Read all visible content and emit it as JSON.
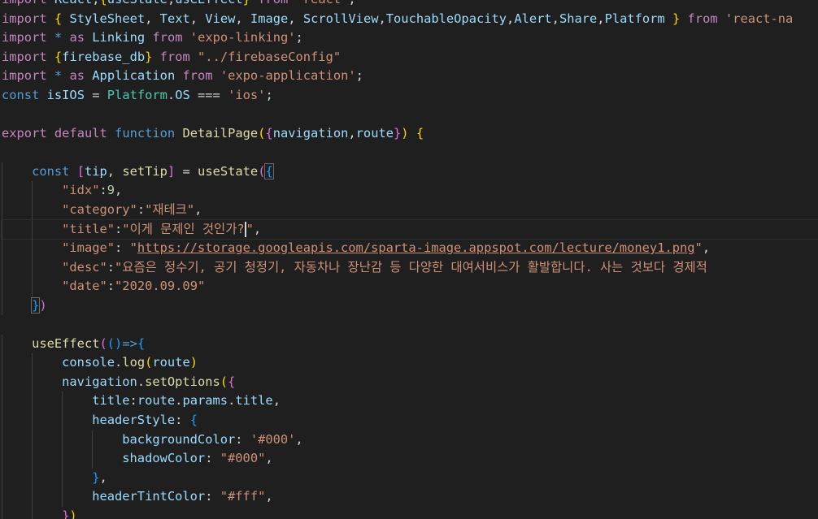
{
  "editor": {
    "language": "javascript",
    "lines": [
      [
        [
          "kw-ctrl",
          "import"
        ],
        [
          "pun",
          " "
        ],
        [
          "var",
          "React"
        ],
        [
          "pun",
          ","
        ],
        [
          "b1",
          "{"
        ],
        [
          "var",
          "useState"
        ],
        [
          "pun",
          ","
        ],
        [
          "var",
          "useEffect"
        ],
        [
          "b1",
          "}"
        ],
        [
          "pun",
          " "
        ],
        [
          "kw-ctrl",
          "from"
        ],
        [
          "pun",
          " "
        ],
        [
          "str",
          "'react'"
        ],
        [
          "pun",
          ";"
        ]
      ],
      [
        [
          "kw-ctrl",
          "import"
        ],
        [
          "pun",
          " "
        ],
        [
          "b1",
          "{"
        ],
        [
          "pun",
          " "
        ],
        [
          "var",
          "StyleSheet"
        ],
        [
          "pun",
          ", "
        ],
        [
          "var",
          "Text"
        ],
        [
          "pun",
          ", "
        ],
        [
          "var",
          "View"
        ],
        [
          "pun",
          ", "
        ],
        [
          "var",
          "Image"
        ],
        [
          "pun",
          ", "
        ],
        [
          "var",
          "ScrollView"
        ],
        [
          "pun",
          ","
        ],
        [
          "var",
          "TouchableOpacity"
        ],
        [
          "pun",
          ","
        ],
        [
          "var",
          "Alert"
        ],
        [
          "pun",
          ","
        ],
        [
          "var",
          "Share"
        ],
        [
          "pun",
          ","
        ],
        [
          "var",
          "Platform"
        ],
        [
          "pun",
          " "
        ],
        [
          "b1",
          "}"
        ],
        [
          "pun",
          " "
        ],
        [
          "kw-ctrl",
          "from"
        ],
        [
          "pun",
          " "
        ],
        [
          "str",
          "'react-na"
        ]
      ],
      [
        [
          "kw-ctrl",
          "import"
        ],
        [
          "pun",
          " "
        ],
        [
          "kw",
          "*"
        ],
        [
          "pun",
          " "
        ],
        [
          "kw-ctrl",
          "as"
        ],
        [
          "pun",
          " "
        ],
        [
          "var",
          "Linking"
        ],
        [
          "pun",
          " "
        ],
        [
          "kw-ctrl",
          "from"
        ],
        [
          "pun",
          " "
        ],
        [
          "str",
          "'expo-linking'"
        ],
        [
          "pun",
          ";"
        ]
      ],
      [
        [
          "kw-ctrl",
          "import"
        ],
        [
          "pun",
          " "
        ],
        [
          "b1",
          "{"
        ],
        [
          "var",
          "firebase_db"
        ],
        [
          "b1",
          "}"
        ],
        [
          "pun",
          " "
        ],
        [
          "kw-ctrl",
          "from"
        ],
        [
          "pun",
          " "
        ],
        [
          "str",
          "\"../firebaseConfig\""
        ]
      ],
      [
        [
          "kw-ctrl",
          "import"
        ],
        [
          "pun",
          " "
        ],
        [
          "kw",
          "*"
        ],
        [
          "pun",
          " "
        ],
        [
          "kw-ctrl",
          "as"
        ],
        [
          "pun",
          " "
        ],
        [
          "var",
          "Application"
        ],
        [
          "pun",
          " "
        ],
        [
          "kw-ctrl",
          "from"
        ],
        [
          "pun",
          " "
        ],
        [
          "str",
          "'expo-application'"
        ],
        [
          "pun",
          ";"
        ]
      ],
      [
        [
          "kw",
          "const"
        ],
        [
          "pun",
          " "
        ],
        [
          "var",
          "isIOS"
        ],
        [
          "pun",
          " = "
        ],
        [
          "cls",
          "Platform"
        ],
        [
          "pun",
          "."
        ],
        [
          "var",
          "OS"
        ],
        [
          "pun",
          " === "
        ],
        [
          "str",
          "'ios'"
        ],
        [
          "pun",
          ";"
        ]
      ],
      [],
      [
        [
          "kw-ctrl",
          "export"
        ],
        [
          "pun",
          " "
        ],
        [
          "kw-ctrl",
          "default"
        ],
        [
          "pun",
          " "
        ],
        [
          "kw",
          "function"
        ],
        [
          "pun",
          " "
        ],
        [
          "fn",
          "DetailPage"
        ],
        [
          "b1",
          "("
        ],
        [
          "b2",
          "{"
        ],
        [
          "var",
          "navigation"
        ],
        [
          "pun",
          ","
        ],
        [
          "var",
          "route"
        ],
        [
          "b2",
          "}"
        ],
        [
          "b1",
          ")"
        ],
        [
          "pun",
          " "
        ],
        [
          "b1",
          "{"
        ]
      ],
      [],
      [
        [
          "pun",
          "    "
        ],
        [
          "kw",
          "const"
        ],
        [
          "pun",
          " "
        ],
        [
          "b2",
          "["
        ],
        [
          "var",
          "tip"
        ],
        [
          "pun",
          ", "
        ],
        [
          "fn",
          "setTip"
        ],
        [
          "b2",
          "]"
        ],
        [
          "pun",
          " = "
        ],
        [
          "fn",
          "useState"
        ],
        [
          "b2",
          "("
        ],
        [
          "b3bhl",
          "{"
        ]
      ],
      [
        [
          "pun",
          "        "
        ],
        [
          "str",
          "\"idx\""
        ],
        [
          "pun",
          ":"
        ],
        [
          "num",
          "9"
        ],
        [
          "pun",
          ","
        ]
      ],
      [
        [
          "pun",
          "        "
        ],
        [
          "str",
          "\"category\""
        ],
        [
          "pun",
          ":"
        ],
        [
          "str",
          "\"재테크\""
        ],
        [
          "pun",
          ","
        ]
      ],
      [
        [
          "pun",
          "        "
        ],
        [
          "str",
          "\"title\""
        ],
        [
          "pun",
          ":"
        ],
        [
          "str",
          "\"이게 문제인 것인가?"
        ],
        [
          "caret",
          ""
        ],
        [
          "str",
          "\""
        ],
        [
          "pun",
          ","
        ]
      ],
      [
        [
          "pun",
          "        "
        ],
        [
          "str",
          "\"image\""
        ],
        [
          "pun",
          ": "
        ],
        [
          "str",
          "\""
        ],
        [
          "url",
          "https://storage.googleapis.com/sparta-image.appspot.com/lecture/money1.png"
        ],
        [
          "str",
          "\""
        ],
        [
          "pun",
          ","
        ]
      ],
      [
        [
          "pun",
          "        "
        ],
        [
          "str",
          "\"desc\""
        ],
        [
          "pun",
          ":"
        ],
        [
          "str",
          "\"요즘은 정수기, 공기 청정기, 자동차나 장난감 등 다양한 대여서비스가 활발합니다. 사는 것보다 경제적"
        ]
      ],
      [
        [
          "pun",
          "        "
        ],
        [
          "str",
          "\"date\""
        ],
        [
          "pun",
          ":"
        ],
        [
          "str",
          "\"2020.09.09\""
        ]
      ],
      [
        [
          "pun",
          "    "
        ],
        [
          "b3bhl",
          "}"
        ],
        [
          "b2",
          ")"
        ]
      ],
      [],
      [
        [
          "pun",
          "    "
        ],
        [
          "fn",
          "useEffect"
        ],
        [
          "b2",
          "("
        ],
        [
          "b3",
          "()"
        ],
        [
          "kw",
          "=>"
        ],
        [
          "b3",
          "{"
        ]
      ],
      [
        [
          "pun",
          "        "
        ],
        [
          "var",
          "console"
        ],
        [
          "pun",
          "."
        ],
        [
          "fn",
          "log"
        ],
        [
          "b1",
          "("
        ],
        [
          "var",
          "route"
        ],
        [
          "b1",
          ")"
        ]
      ],
      [
        [
          "pun",
          "        "
        ],
        [
          "var",
          "navigation"
        ],
        [
          "pun",
          "."
        ],
        [
          "fn",
          "setOptions"
        ],
        [
          "b1",
          "("
        ],
        [
          "b2",
          "{"
        ]
      ],
      [
        [
          "pun",
          "            "
        ],
        [
          "var",
          "title"
        ],
        [
          "pun",
          ":"
        ],
        [
          "var",
          "route"
        ],
        [
          "pun",
          "."
        ],
        [
          "var",
          "params"
        ],
        [
          "pun",
          "."
        ],
        [
          "var",
          "title"
        ],
        [
          "pun",
          ","
        ]
      ],
      [
        [
          "pun",
          "            "
        ],
        [
          "var",
          "headerStyle"
        ],
        [
          "pun",
          ": "
        ],
        [
          "b3",
          "{"
        ]
      ],
      [
        [
          "pun",
          "                "
        ],
        [
          "var",
          "backgroundColor"
        ],
        [
          "pun",
          ": "
        ],
        [
          "str",
          "'#000'"
        ],
        [
          "pun",
          ","
        ]
      ],
      [
        [
          "pun",
          "                "
        ],
        [
          "var",
          "shadowColor"
        ],
        [
          "pun",
          ": "
        ],
        [
          "str",
          "\"#000\""
        ],
        [
          "pun",
          ","
        ]
      ],
      [
        [
          "pun",
          "            "
        ],
        [
          "b3",
          "}"
        ],
        [
          "pun",
          ","
        ]
      ],
      [
        [
          "pun",
          "            "
        ],
        [
          "var",
          "headerTintColor"
        ],
        [
          "pun",
          ": "
        ],
        [
          "str",
          "\"#fff\""
        ],
        [
          "pun",
          ","
        ]
      ],
      [
        [
          "pun",
          "        "
        ],
        [
          "b2",
          "}"
        ],
        [
          "b1",
          ")"
        ]
      ]
    ],
    "current_line": 12,
    "colors": {
      "background": "#1f1f1f",
      "keyword_control": "#c586c0",
      "keyword": "#569cd6",
      "function": "#dcdcaa",
      "variable": "#9cdcfe",
      "class": "#4ec9b0",
      "string": "#ce9178",
      "number": "#b5cea8",
      "bracket_1": "#ffd700",
      "bracket_2": "#da70d6",
      "bracket_3": "#179fff"
    }
  }
}
